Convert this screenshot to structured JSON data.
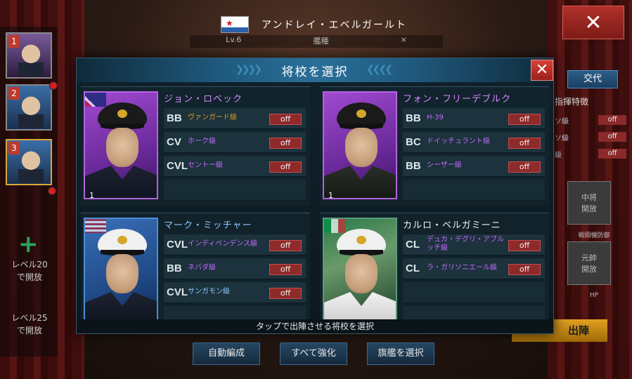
{
  "background": {
    "flag": "soviet-navy-flag",
    "officer_name": "アンドレイ・エベルガールト",
    "stat_row": [
      "Lv.6",
      "艦種",
      "×"
    ],
    "close_label": "✕",
    "swap_label": "交代",
    "command_trait_title": "指揮特徴",
    "trait_rows": [
      {
        "label": "ソ級",
        "state": "off"
      },
      {
        "label": "ソ級",
        "state": "off"
      },
      {
        "label": "級",
        "state": "off"
      }
    ],
    "badge1": "中将\n開放",
    "badge1_caption": "戦闘機防御",
    "badge2": "元帥\n開放",
    "badge2_caption": "HP",
    "deploy_label": "出陣",
    "left_rail": {
      "slots": [
        "1",
        "2",
        "3"
      ],
      "plus": "+",
      "lock_20": "レベル20\nで開放",
      "lock_25": "レベル25\nで開放"
    },
    "bottom_buttons": [
      "自動編成",
      "すべて強化",
      "旗艦を選択"
    ]
  },
  "modal": {
    "title": "将校を選択",
    "close": "✕",
    "footer": "タップで出陣させる将校を選択",
    "officers": [
      {
        "name": "ジョン・ロベック",
        "name_color": "#d58aff",
        "stars": "1",
        "frame": "purple",
        "skills": [
          {
            "type": "BB",
            "ship": "ヴァンガード級",
            "state": "off",
            "ship_color": "#e09a2a"
          },
          {
            "type": "CV",
            "ship": "ホーク級",
            "state": "off",
            "ship_color": "#c26bff"
          },
          {
            "type": "CVL",
            "ship": "セントー級",
            "state": "off",
            "ship_color": "#c26bff"
          }
        ]
      },
      {
        "name": "フォン・フリーデブルク",
        "name_color": "#d58aff",
        "stars": "1",
        "frame": "purple",
        "skills": [
          {
            "type": "BB",
            "ship": "H-39",
            "state": "off",
            "ship_color": "#c26bff"
          },
          {
            "type": "BC",
            "ship": "ドイッチュラント級",
            "state": "off",
            "ship_color": "#c26bff"
          },
          {
            "type": "BB",
            "ship": "シーザー級",
            "state": "off",
            "ship_color": "#c26bff"
          }
        ]
      },
      {
        "name": "マーク・ミッチャー",
        "name_color": "#8ec8ff",
        "stars": "",
        "frame": "blue",
        "skills": [
          {
            "type": "CVL",
            "ship": "インディペンデンス級",
            "state": "off",
            "ship_color": "#c26bff"
          },
          {
            "type": "BB",
            "ship": "ネバダ級",
            "state": "off",
            "ship_color": "#c26bff"
          },
          {
            "type": "CVL",
            "ship": "サンガモン級",
            "state": "off",
            "ship_color": "#8ec8ff"
          }
        ]
      },
      {
        "name": "カルロ・ベルガミーニ",
        "name_color": "#f2f2f2",
        "stars": "",
        "frame": "green",
        "skills": [
          {
            "type": "CL",
            "ship": "デュカ・デグリ・アブルッチ級",
            "state": "off",
            "ship_color": "#c26bff"
          },
          {
            "type": "CL",
            "ship": "ラ・ガリソニエール級",
            "state": "off",
            "ship_color": "#c26bff"
          }
        ]
      }
    ]
  }
}
